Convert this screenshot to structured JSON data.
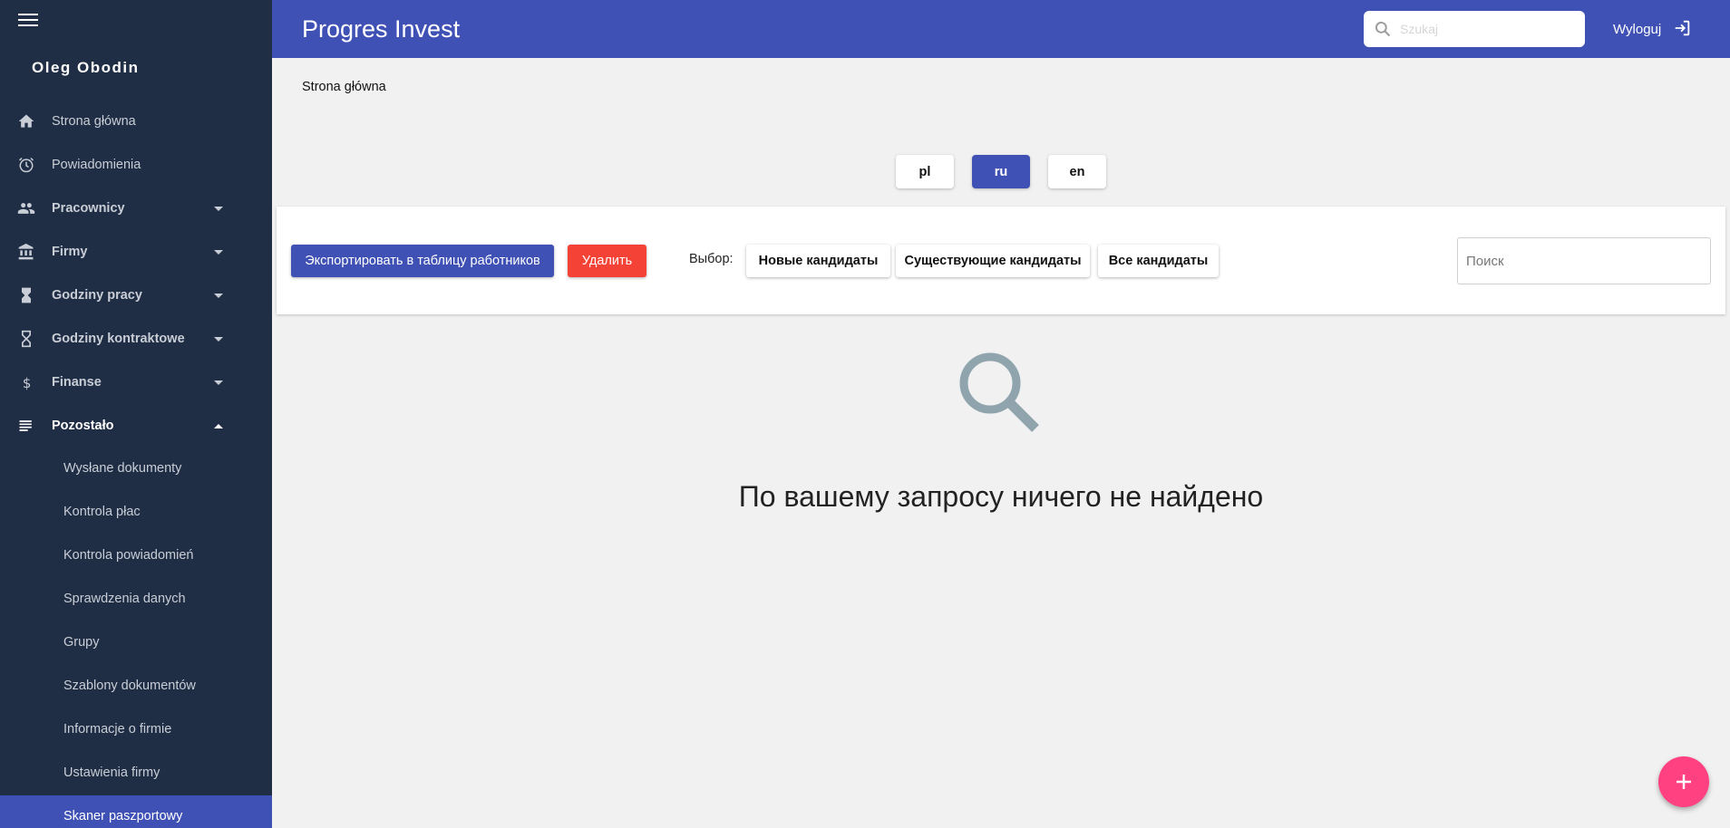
{
  "app": {
    "title": "Progres Invest"
  },
  "user": {
    "name": "Oleg Obodin"
  },
  "header": {
    "search_placeholder": "Szukaj",
    "logout_label": "Wyloguj"
  },
  "sidebar": {
    "items": [
      {
        "label": "Strona główna",
        "icon": "home-icon"
      },
      {
        "label": "Powiadomienia",
        "icon": "alarm-icon"
      },
      {
        "label": "Pracownicy",
        "icon": "people-icon",
        "expandable": true
      },
      {
        "label": "Firmy",
        "icon": "bank-icon",
        "expandable": true
      },
      {
        "label": "Godziny pracy",
        "icon": "hourglass-filled-icon",
        "expandable": true
      },
      {
        "label": "Godziny kontraktowe",
        "icon": "hourglass-icon",
        "expandable": true
      },
      {
        "label": "Finanse",
        "icon": "dollar-icon",
        "expandable": true
      },
      {
        "label": "Pozostało",
        "icon": "list-icon",
        "expandable": true,
        "expanded": true
      }
    ],
    "sub_items": [
      {
        "label": "Wysłane dokumenty"
      },
      {
        "label": "Kontrola płac"
      },
      {
        "label": "Kontrola powiadomień"
      },
      {
        "label": "Sprawdzenia danych"
      },
      {
        "label": "Grupy"
      },
      {
        "label": "Szablony dokumentów"
      },
      {
        "label": "Informacje o firmie"
      },
      {
        "label": "Ustawienia firmy"
      },
      {
        "label": "Skaner paszportowy",
        "active": true
      }
    ]
  },
  "breadcrumb": {
    "current": "Strona główna"
  },
  "languages": {
    "items": [
      "pl",
      "ru",
      "en"
    ],
    "active": "ru"
  },
  "toolbar": {
    "export_label": "Экспортировать в таблицу работников",
    "delete_label": "Удалить",
    "filter_label": "Выбор:",
    "filters": [
      "Новые кандидаты",
      "Существующие кандидаты",
      "Все кандидаты"
    ],
    "search_placeholder": "Поиск"
  },
  "empty_state": {
    "message": "По вашему запросу ничего не найдено"
  },
  "colors": {
    "primary": "#3f51b5",
    "danger": "#f44336",
    "fab": "#ff4081",
    "sidebar": "#1f2d45"
  }
}
